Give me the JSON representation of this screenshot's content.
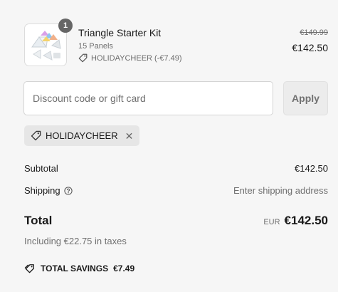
{
  "product": {
    "quantity": "1",
    "title": "Triangle Starter Kit",
    "variant": "15 Panels",
    "discount_label": "HOLIDAYCHEER (-€7.49)",
    "original_price": "€149.99",
    "price": "€142.50",
    "thumbnail_icon": "product-image-icon"
  },
  "discount": {
    "placeholder": "Discount code or gift card",
    "apply_label": "Apply",
    "applied_code": "HOLIDAYCHEER",
    "tag_icon": "tag-icon",
    "remove_icon": "close-icon",
    "remove_glyph": "✕"
  },
  "summary": {
    "subtotal_label": "Subtotal",
    "subtotal_value": "€142.50",
    "shipping_label": "Shipping",
    "shipping_info_icon": "question-circle-icon",
    "shipping_value": "Enter shipping address",
    "total_label": "Total",
    "currency": "EUR",
    "total_value": "€142.50",
    "taxes_note": "Including €22.75 in taxes",
    "savings_label": "TOTAL SAVINGS",
    "savings_value": "€7.49",
    "savings_icon": "tags-icon"
  },
  "colors": {
    "background": "#f6f6f6",
    "qty_badge": "#666666",
    "muted_text": "#707070",
    "tag_background": "#e6e6e6"
  }
}
